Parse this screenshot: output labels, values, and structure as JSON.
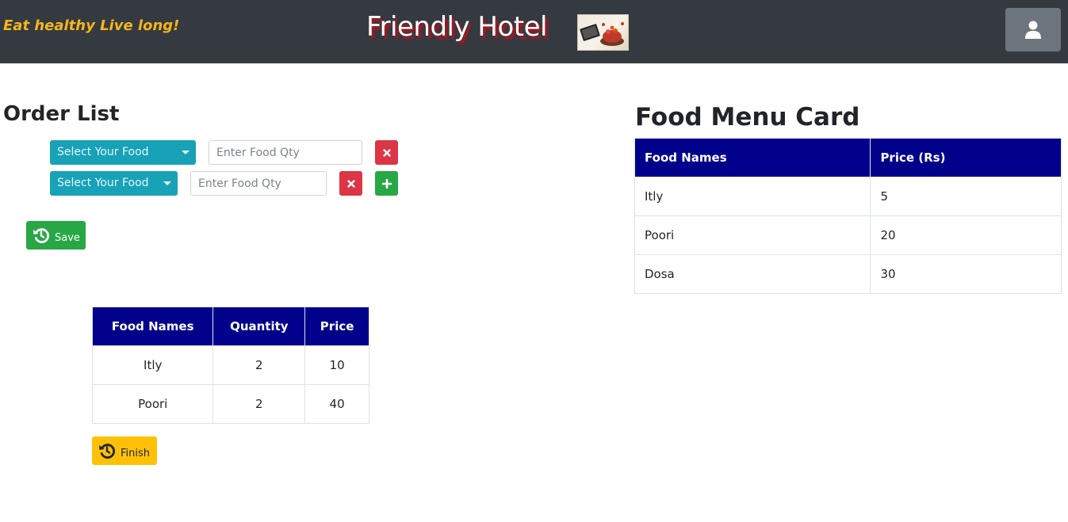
{
  "header": {
    "tagline": "Eat healthy Live long!",
    "brand": "Friendly Hotel",
    "brand_image": "food-tablet-photo",
    "user_icon": "user-icon"
  },
  "order": {
    "title": "Order List",
    "rows": [
      {
        "select_label": "Select Your Food",
        "qty_placeholder": "Enter Food Qty"
      },
      {
        "select_label": "Select Your Food",
        "qty_placeholder": "Enter Food Qty"
      }
    ],
    "save_label": "Save",
    "finish_label": "Finish"
  },
  "order_table": {
    "headers": [
      "Food Names",
      "Quantity",
      "Price"
    ],
    "rows": [
      [
        "Itly",
        "2",
        "10"
      ],
      [
        "Poori",
        "2",
        "40"
      ]
    ]
  },
  "menu": {
    "title": "Food Menu Card",
    "headers": [
      "Food Names",
      "Price (Rs)"
    ],
    "rows": [
      [
        "Itly",
        "5"
      ],
      [
        "Poori",
        "20"
      ],
      [
        "Dosa",
        "30"
      ]
    ]
  },
  "colors": {
    "navbar": "#343a40",
    "tagline": "#f7b51a",
    "table_header": "#00008b",
    "info": "#17a2b8",
    "danger": "#dc3545",
    "success": "#28a745",
    "warning": "#ffc107",
    "secondary": "#6c757d"
  }
}
